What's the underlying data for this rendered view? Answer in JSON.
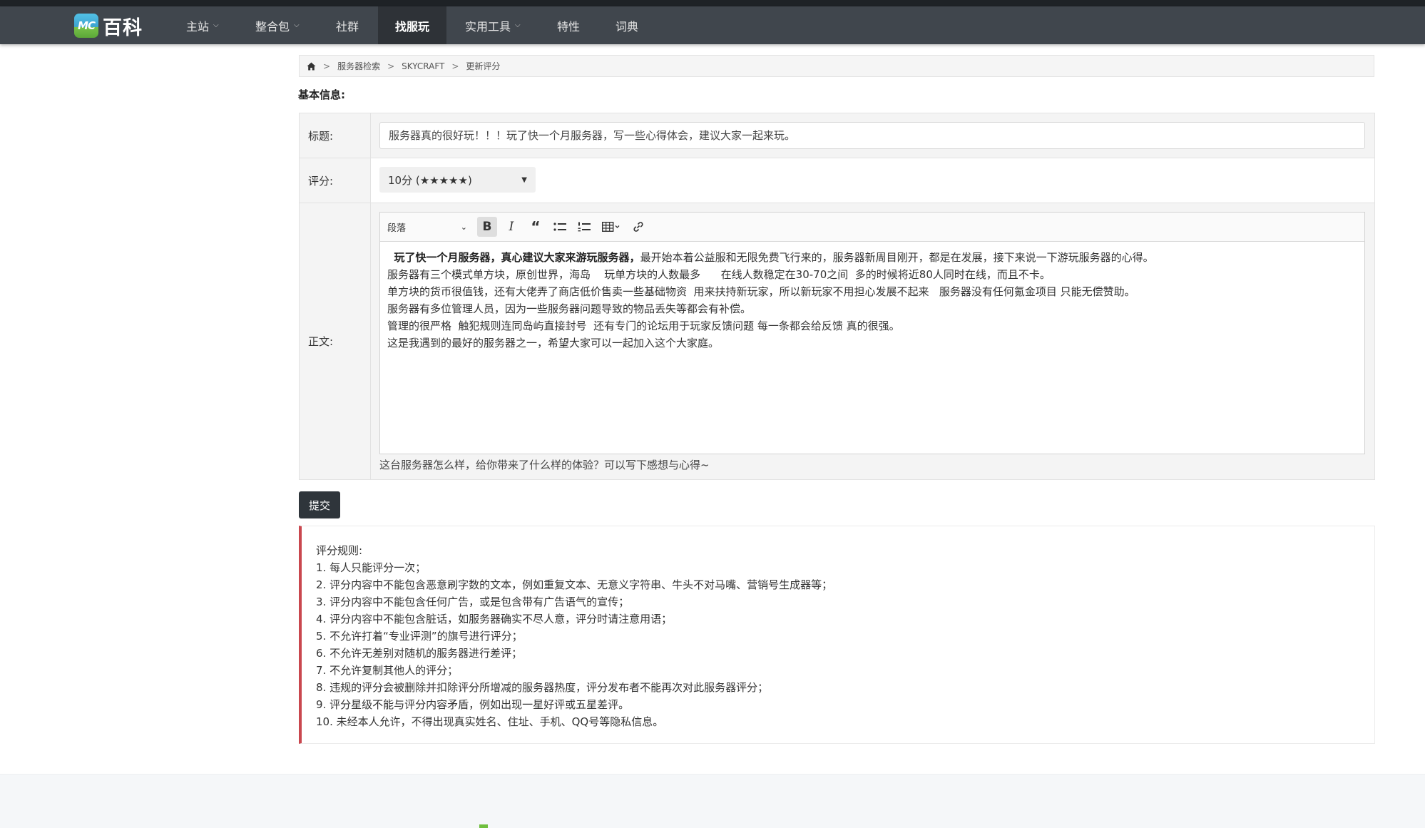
{
  "nav": {
    "logo_badge": "MC",
    "logo_text": "百科",
    "items": [
      {
        "label": "主站",
        "caret": true
      },
      {
        "label": "整合包",
        "caret": true
      },
      {
        "label": "社群",
        "caret": false
      },
      {
        "label": "找服玩",
        "caret": false,
        "active": true
      },
      {
        "label": "实用工具",
        "caret": true
      },
      {
        "label": "特性",
        "caret": false
      },
      {
        "label": "词典",
        "caret": false
      }
    ]
  },
  "breadcrumb": {
    "home_icon": "home-icon",
    "items": [
      "服务器检索",
      "SKYCRAFT",
      "更新评分"
    ],
    "separator": ">"
  },
  "form": {
    "section_title": "基本信息:",
    "title_label": "标题:",
    "title_value": "服务器真的很好玩！！！玩了快一个月服务器，写一些心得体会，建议大家一起来玩。",
    "rating_label": "评分:",
    "rating_value": "10分 (★★★★★)",
    "body_label": "正文:",
    "editor": {
      "heading_value": "段落",
      "tools": [
        "bold-icon",
        "italic-icon",
        "quote-icon",
        "bulleted-list-icon",
        "numbered-list-icon",
        "table-icon",
        "link-icon"
      ],
      "lead_bold": "玩了快一个月服务器，真心建议大家来游玩服务器，",
      "lead_rest": "最开始本着公益服和无限免费飞行来的，服务器新周目刚开，都是在发展，接下来说一下游玩服务器的心得。",
      "lines": [
        "服务器有三个模式单方块，原创世界，海岛    玩单方块的人数最多      在线人数稳定在30-70之间  多的时候将近80人同时在线，而且不卡。",
        "单方块的货币很值钱，还有大佬弄了商店低价售卖一些基础物资  用来扶持新玩家，所以新玩家不用担心发展不起来   服务器没有任何氪金项目 只能无偿赞助。",
        "服务器有多位管理人员，因为一些服务器问题导致的物品丢失等都会有补偿。",
        "管理的很严格  触犯规则连同岛屿直接封号  还有专门的论坛用于玩家反馈问题 每一条都会给反馈 真的很强。",
        "这是我遇到的最好的服务器之一，希望大家可以一起加入这个大家庭。"
      ]
    },
    "hint": "这台服务器怎么样，给你带来了什么样的体验？可以写下感想与心得~",
    "submit_label": "提交"
  },
  "rules": {
    "title": "评分规则:",
    "items": [
      "1. 每人只能评分一次；",
      "2. 评分内容中不能包含恶意刷字数的文本，例如重复文本、无意义字符串、牛头不对马嘴、营销号生成器等；",
      "3. 评分内容中不能包含任何广告，或是包含带有广告语气的宣传；",
      "4. 评分内容中不能包含脏话，如服务器确实不尽人意，评分时请注意用语；",
      "5. 不允许打着“专业评测”的旗号进行评分；",
      "6. 不允许无差别对随机的服务器进行差评；",
      "7. 不允许复制其他人的评分；",
      "8. 违规的评分会被删除并扣除评分所增减的服务器热度，评分发布者不能再次对此服务器评分；",
      "9. 评分星级不能与评分内容矛盾，例如出现一星好评或五星差评。",
      "10. 未经本人允许，不得出现真实姓名、住址、手机、QQ号等隐私信息。"
    ],
    "accent_color": "#c9474e"
  },
  "colors": {
    "navbar": "#40464d",
    "nav_active": "#2e3237",
    "submit": "#2f353b"
  }
}
